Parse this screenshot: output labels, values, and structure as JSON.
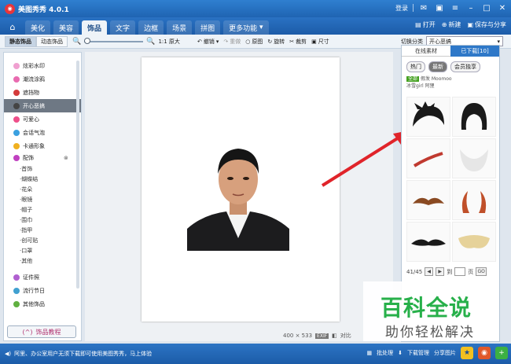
{
  "app": {
    "title": "美图秀秀 4.0.1"
  },
  "window": {
    "login": "登录"
  },
  "nav": {
    "tabs": [
      "美化",
      "美容",
      "饰品",
      "文字",
      "边框",
      "场景",
      "拼图",
      "更多功能"
    ],
    "open": "打开",
    "new": "新建",
    "save": "保存与分享"
  },
  "toolbar": {
    "subtab_static": "静态饰品",
    "subtab_dynamic": "动态饰品",
    "ratio": "1:1 原大",
    "undo": "撤销",
    "redo": "重做",
    "original": "原图",
    "rotate": "旋转",
    "crop": "裁剪",
    "size": "尺寸",
    "category_label": "切换分类",
    "category_value": "开心恶搞"
  },
  "sidebar": {
    "items_top": [
      "炫彩水印",
      "潮流涂鸦",
      "遮挡物",
      "开心恶搞",
      "可爱心",
      "会话气泡",
      "卡通形象"
    ],
    "active_index": 3,
    "accessory_head": "配饰",
    "accessory_items": [
      "首饰",
      "蝴蝶结",
      "花朵",
      "眼镜",
      "帽子",
      "围巾",
      "指甲",
      "创可贴",
      "口罩",
      "其他"
    ],
    "items_bottom": [
      "证件照",
      "流行节日",
      "其他饰品"
    ],
    "footer": "饰品教程"
  },
  "canvas": {
    "dimensions": "400 × 533",
    "exif": "EXIF",
    "compare": "对比"
  },
  "right_panel": {
    "tab_online": "在线素材",
    "tab_downloaded": "已下载[10]",
    "pills": [
      "热门",
      "最新",
      "会员独享"
    ],
    "filter_all": "全部",
    "filters": [
      "假发",
      "Moomoo",
      "冰雪girl",
      "阿狸"
    ],
    "pager_count": "41/45",
    "pager_to": "到",
    "pager_page": "页",
    "pager_go": "GO"
  },
  "watermark": {
    "title": "百科全说",
    "subtitle": "助你轻松解决"
  },
  "statusbar": {
    "tip": "阿里、办公室用户无须下载即可使用美图秀秀，马上体验",
    "batch": "批处理",
    "download": "下载管理",
    "share": "分享图片"
  },
  "colors": {
    "accent": "#1f64b2",
    "watermark_green": "#27b04a",
    "arrow_red": "#e0242a"
  }
}
